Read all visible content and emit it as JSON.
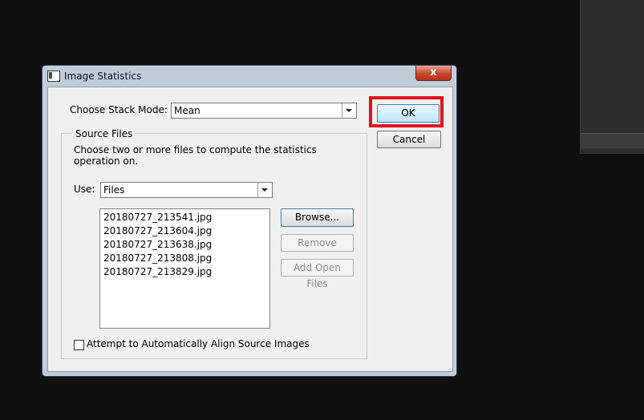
{
  "dialog": {
    "title": "Image Statistics",
    "close_glyph": "x",
    "stack_mode_label": "Choose Stack Mode:",
    "stack_mode_value": "Mean",
    "ok_label": "OK",
    "cancel_label": "Cancel",
    "source_files": {
      "group_title": "Source Files",
      "description_line1": "Choose two or more files to compute the statistics",
      "description_line2": "operation on.",
      "use_label": "Use:",
      "use_value": "Files",
      "files": [
        "20180727_213541.jpg",
        "20180727_213604.jpg",
        "20180727_213638.jpg",
        "20180727_213808.jpg",
        "20180727_213829.jpg"
      ],
      "browse_label": "Browse...",
      "remove_label": "Remove",
      "add_open_files_label": "Add Open Files",
      "align_checkbox_label": "Attempt to Automatically Align Source Images",
      "align_checked": false
    }
  },
  "colors": {
    "highlight": "#e0121b",
    "window_frame": "#bfcddb",
    "dialog_bg": "#f0f0f0"
  }
}
